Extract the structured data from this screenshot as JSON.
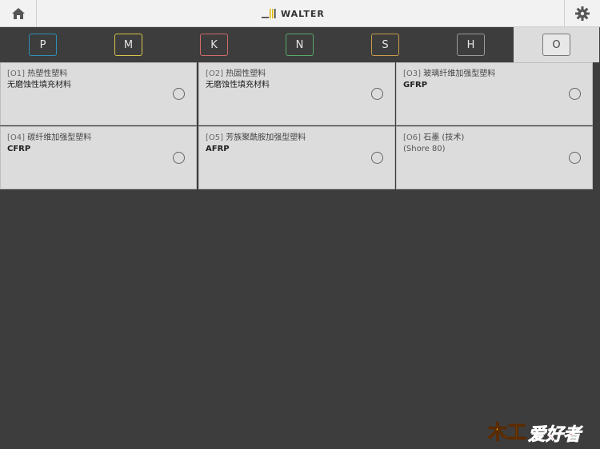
{
  "header": {
    "brand": "WALTER",
    "home_icon": "home-icon",
    "settings_icon": "gear-icon"
  },
  "tabs": [
    {
      "label": "P",
      "color": "#2f8fb8",
      "active": false
    },
    {
      "label": "M",
      "color": "#d8c44a",
      "active": false
    },
    {
      "label": "K",
      "color": "#d06a6a",
      "active": false
    },
    {
      "label": "N",
      "color": "#5aa86a",
      "active": false
    },
    {
      "label": "S",
      "color": "#c99b4e",
      "active": false
    },
    {
      "label": "H",
      "color": "#9a9a9a",
      "active": false
    },
    {
      "label": "O",
      "color": "#777777",
      "active": true
    }
  ],
  "materials": [
    {
      "code": "[O1]",
      "name": "热塑性塑料",
      "sub": "无磨蚀性填充材料",
      "sub_style": "normal"
    },
    {
      "code": "[O2]",
      "name": "热固性塑料",
      "sub": "无磨蚀性填充材料",
      "sub_style": "normal"
    },
    {
      "code": "[O3]",
      "name": "玻璃纤维加强型塑料",
      "sub": "GFRP",
      "sub_style": "bold"
    },
    {
      "code": "[O4]",
      "name": "碳纤维加强型塑料",
      "sub": "CFRP",
      "sub_style": "bold"
    },
    {
      "code": "[O5]",
      "name": "芳族聚酰胺加强型塑料",
      "sub": "AFRP",
      "sub_style": "bold"
    },
    {
      "code": "[O6]",
      "name": "石墨 (技术)",
      "sub": "(Shore 80)",
      "sub_style": "muted"
    }
  ],
  "watermark": {
    "text": "木工爱好者"
  }
}
